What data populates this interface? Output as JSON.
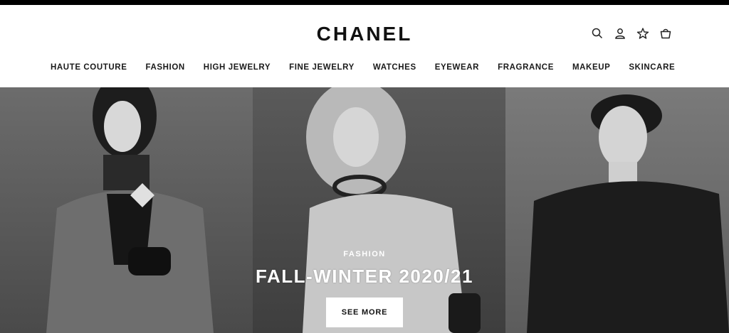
{
  "brand": {
    "logo": "CHANEL"
  },
  "header_icons": [
    "search-icon",
    "account-icon",
    "wishlist-icon",
    "bag-icon"
  ],
  "nav": {
    "items": [
      {
        "label": "HAUTE COUTURE"
      },
      {
        "label": "FASHION"
      },
      {
        "label": "HIGH JEWELRY"
      },
      {
        "label": "FINE JEWELRY"
      },
      {
        "label": "WATCHES"
      },
      {
        "label": "EYEWEAR"
      },
      {
        "label": "FRAGRANCE"
      },
      {
        "label": "MAKEUP"
      },
      {
        "label": "SKINCARE"
      }
    ]
  },
  "hero": {
    "eyebrow": "FASHION",
    "headline": "FALL-WINTER 2020/21",
    "cta_label": "SEE MORE"
  },
  "colors": {
    "topbar": "#000000",
    "text": "#111111",
    "cta_bg": "#ffffff"
  }
}
